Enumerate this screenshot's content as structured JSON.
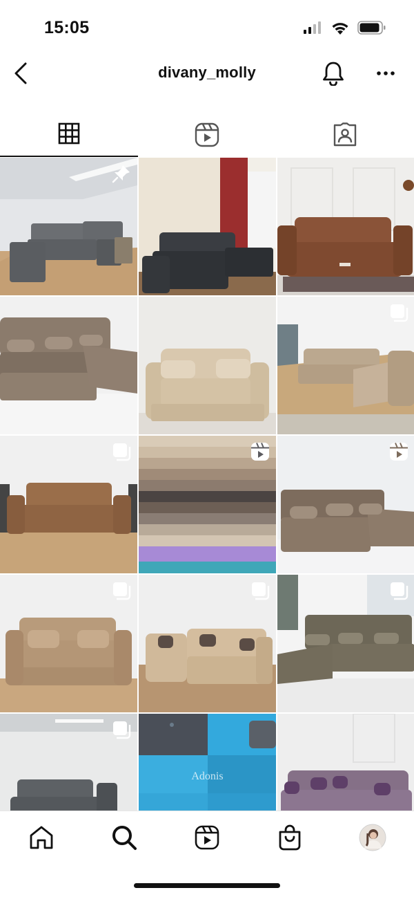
{
  "status_bar": {
    "time": "15:05",
    "icons": [
      "cellular-signal-icon",
      "wifi-icon",
      "battery-icon"
    ]
  },
  "nav": {
    "username": "divany_molly",
    "icons": [
      "back-chevron-icon",
      "bell-icon",
      "more-icon"
    ]
  },
  "tabs": [
    {
      "name": "grid",
      "icon": "grid-icon",
      "active": true
    },
    {
      "name": "reels",
      "icon": "reels-icon",
      "active": false
    },
    {
      "name": "tagged",
      "icon": "tagged-icon",
      "active": false
    }
  ],
  "posts": [
    {
      "row": 1,
      "col": 1,
      "subject": "grey corner sofa",
      "badge": "pin-icon"
    },
    {
      "row": 1,
      "col": 2,
      "subject": "dark grey corner sofa",
      "badge": ""
    },
    {
      "row": 1,
      "col": 3,
      "subject": "brown sofa",
      "badge": ""
    },
    {
      "row": 2,
      "col": 1,
      "subject": "taupe corner sofa",
      "badge": ""
    },
    {
      "row": 2,
      "col": 2,
      "subject": "beige sofa",
      "badge": ""
    },
    {
      "row": 2,
      "col": 3,
      "subject": "beige corner sofa",
      "badge": "carousel-icon"
    },
    {
      "row": 3,
      "col": 1,
      "subject": "brown sofa",
      "badge": "carousel-icon"
    },
    {
      "row": 3,
      "col": 2,
      "subject": "fabric swatches",
      "badge": "reel-icon"
    },
    {
      "row": 3,
      "col": 3,
      "subject": "taupe corner sofa",
      "badge": "reel-icon"
    },
    {
      "row": 4,
      "col": 1,
      "subject": "beige sofa",
      "badge": "carousel-icon"
    },
    {
      "row": 4,
      "col": 2,
      "subject": "beige corner sofa",
      "badge": "carousel-icon"
    },
    {
      "row": 4,
      "col": 3,
      "subject": "olive corner sofa",
      "badge": "carousel-icon"
    },
    {
      "row": 5,
      "col": 1,
      "subject": "grey corner sofa",
      "badge": "carousel-icon"
    },
    {
      "row": 5,
      "col": 2,
      "subject": "blue fabric",
      "badge": "",
      "watermark": "Adonis"
    },
    {
      "row": 5,
      "col": 3,
      "subject": "purple corner sofa",
      "badge": ""
    }
  ],
  "bottom_nav": [
    {
      "name": "home",
      "icon": "home-icon"
    },
    {
      "name": "search",
      "icon": "search-icon",
      "active": true
    },
    {
      "name": "reels",
      "icon": "reels-icon"
    },
    {
      "name": "shop",
      "icon": "shopping-bag-icon"
    },
    {
      "name": "profile",
      "icon": "profile-avatar"
    }
  ],
  "colors": {
    "text": "#111111",
    "divider": "#e6e6e6",
    "background": "#ffffff"
  }
}
